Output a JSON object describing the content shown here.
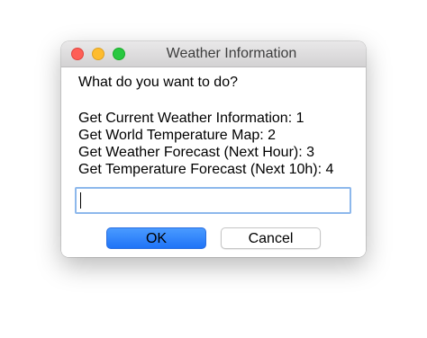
{
  "window": {
    "title": "Weather Information"
  },
  "dialog": {
    "prompt": "What do you want to do?",
    "options": [
      "Get Current Weather Information: 1",
      "Get World Temperature Map: 2",
      "Get Weather Forecast (Next Hour): 3",
      "Get Temperature Forecast (Next 10h): 4"
    ],
    "input_value": ""
  },
  "buttons": {
    "ok_label": "OK",
    "cancel_label": "Cancel"
  },
  "colors": {
    "accent": "#1f73f7",
    "close": "#fe5f57",
    "minimize": "#febc2e",
    "maximize": "#28c840",
    "focus_ring": "#8db8ec"
  }
}
